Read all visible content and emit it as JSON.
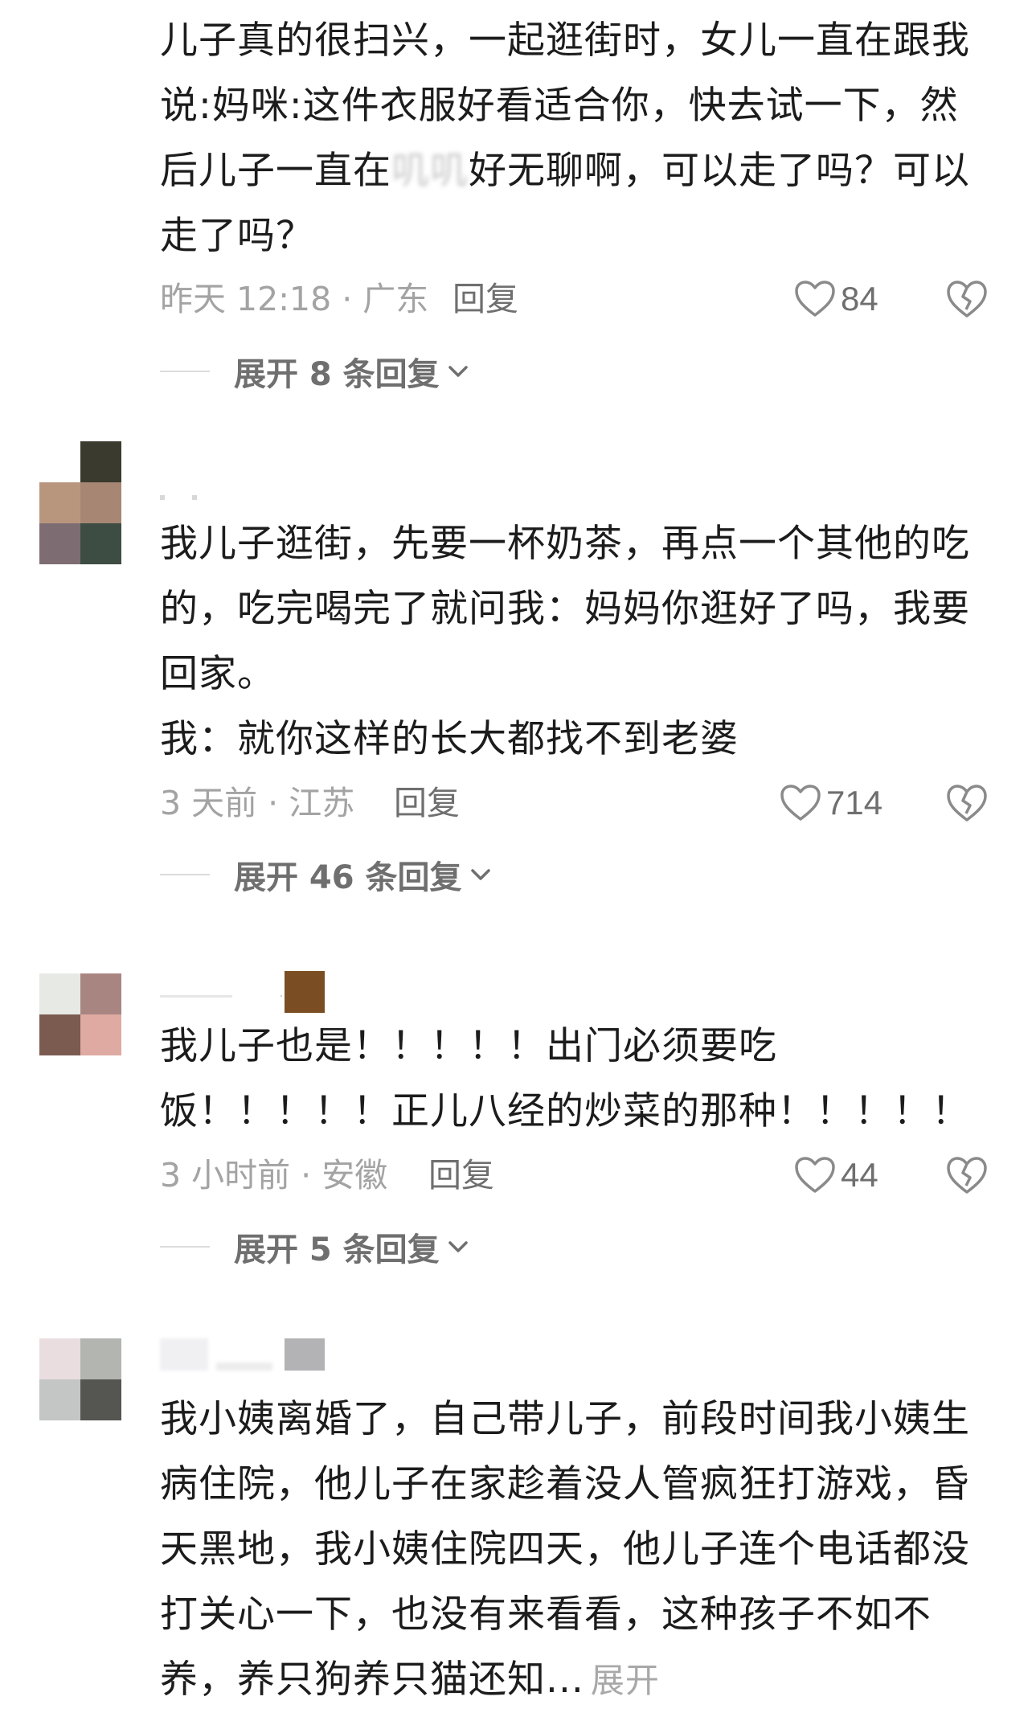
{
  "comments": [
    {
      "text_parts": [
        "儿子真的很扫兴，一起逛街时，女儿一直在跟我说:妈咪:这件衣服好看适合你，快去试一下，然后儿子一直在",
        "叽叽",
        "好无聊啊，可以走了吗？可以走了吗？"
      ],
      "meta": "昨天 12:18 · 广东",
      "reply_label": "回复",
      "likes": "84",
      "expand_label": "展开 8 条回复"
    },
    {
      "lines": [
        "我儿子逛街，先要一杯奶茶，再点一个其他的吃的，吃完喝完了就问我：妈妈你逛好了吗，我要回家。",
        "我：就你这样的长大都找不到老婆"
      ],
      "meta": "3 天前 · 江苏",
      "reply_label": "回复",
      "likes": "714",
      "expand_label": "展开 46 条回复"
    },
    {
      "text": "我儿子也是！！！！！出门必须要吃饭！！！！！正儿八经的炒菜的那种！！！！！",
      "meta": "3 小时前 · 安徽",
      "reply_label": "回复",
      "likes": "44",
      "expand_label": "展开 5 条回复"
    },
    {
      "text": "我小姨离婚了，自己带儿子，前段时间我小姨生病住院，他儿子在家趁着没人管疯狂打游戏，昏天黑地，我小姨住院四天，他儿子连个电话都没打关心一下，也没有来看看，这种孩子不如不养，养只狗养只猫还知...",
      "more_label": "展开"
    }
  ],
  "icons": {
    "like": "heart-outline-icon",
    "dislike": "broken-heart-icon",
    "expand": "chevron-down-icon"
  },
  "colors": {
    "text": "#1c1c1c",
    "meta": "#a3a3a3",
    "action": "#6f6f6f"
  }
}
